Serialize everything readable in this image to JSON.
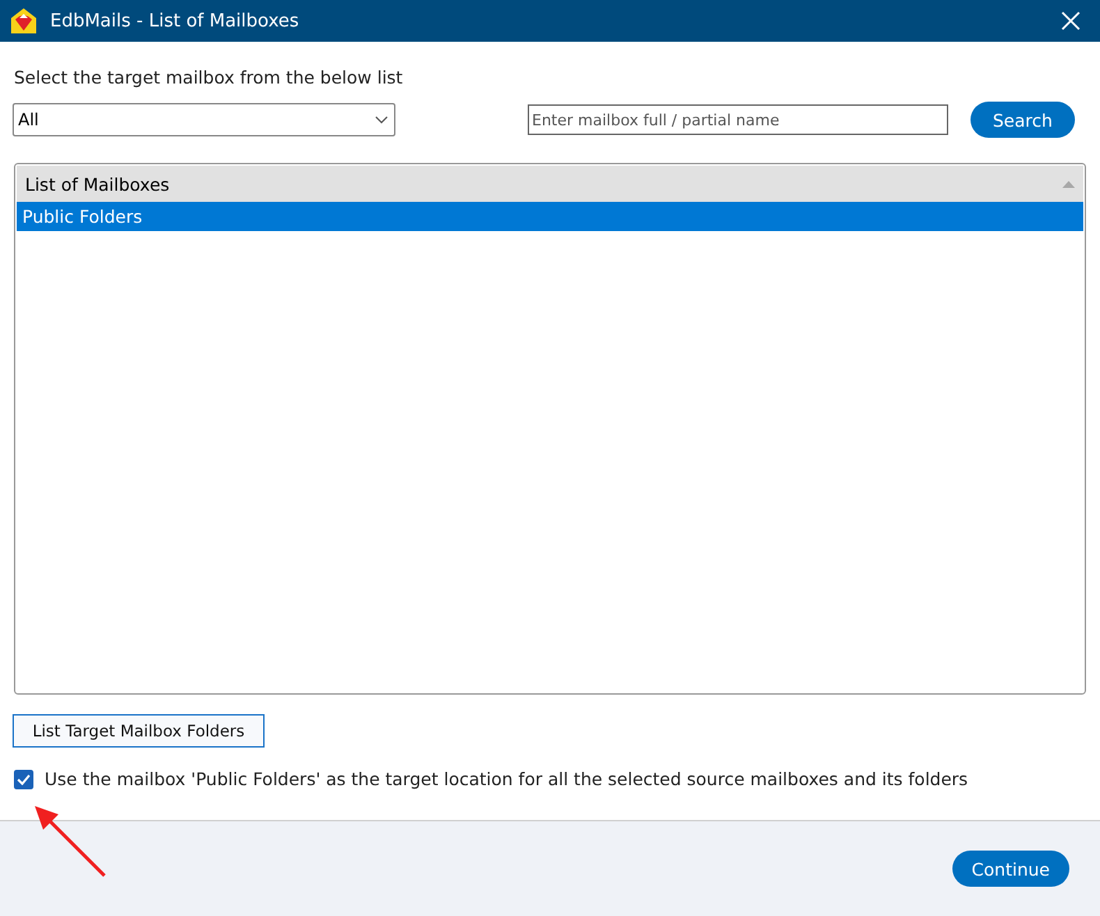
{
  "window": {
    "title": "EdbMails - List of Mailboxes"
  },
  "instruction": "Select the target mailbox from the below list",
  "filter_dropdown": {
    "value": "All"
  },
  "search": {
    "placeholder": "Enter mailbox full / partial name",
    "button": "Search"
  },
  "mailbox_list": {
    "header": "List of Mailboxes",
    "rows": [
      {
        "name": "Public Folders",
        "selected": true
      }
    ]
  },
  "list_folders_button": "List Target Mailbox Folders",
  "target_option": {
    "label": "Use the mailbox 'Public Folders' as the target location for all the selected source mailboxes and its folders",
    "checked": true
  },
  "footer": {
    "button": "Continue"
  }
}
